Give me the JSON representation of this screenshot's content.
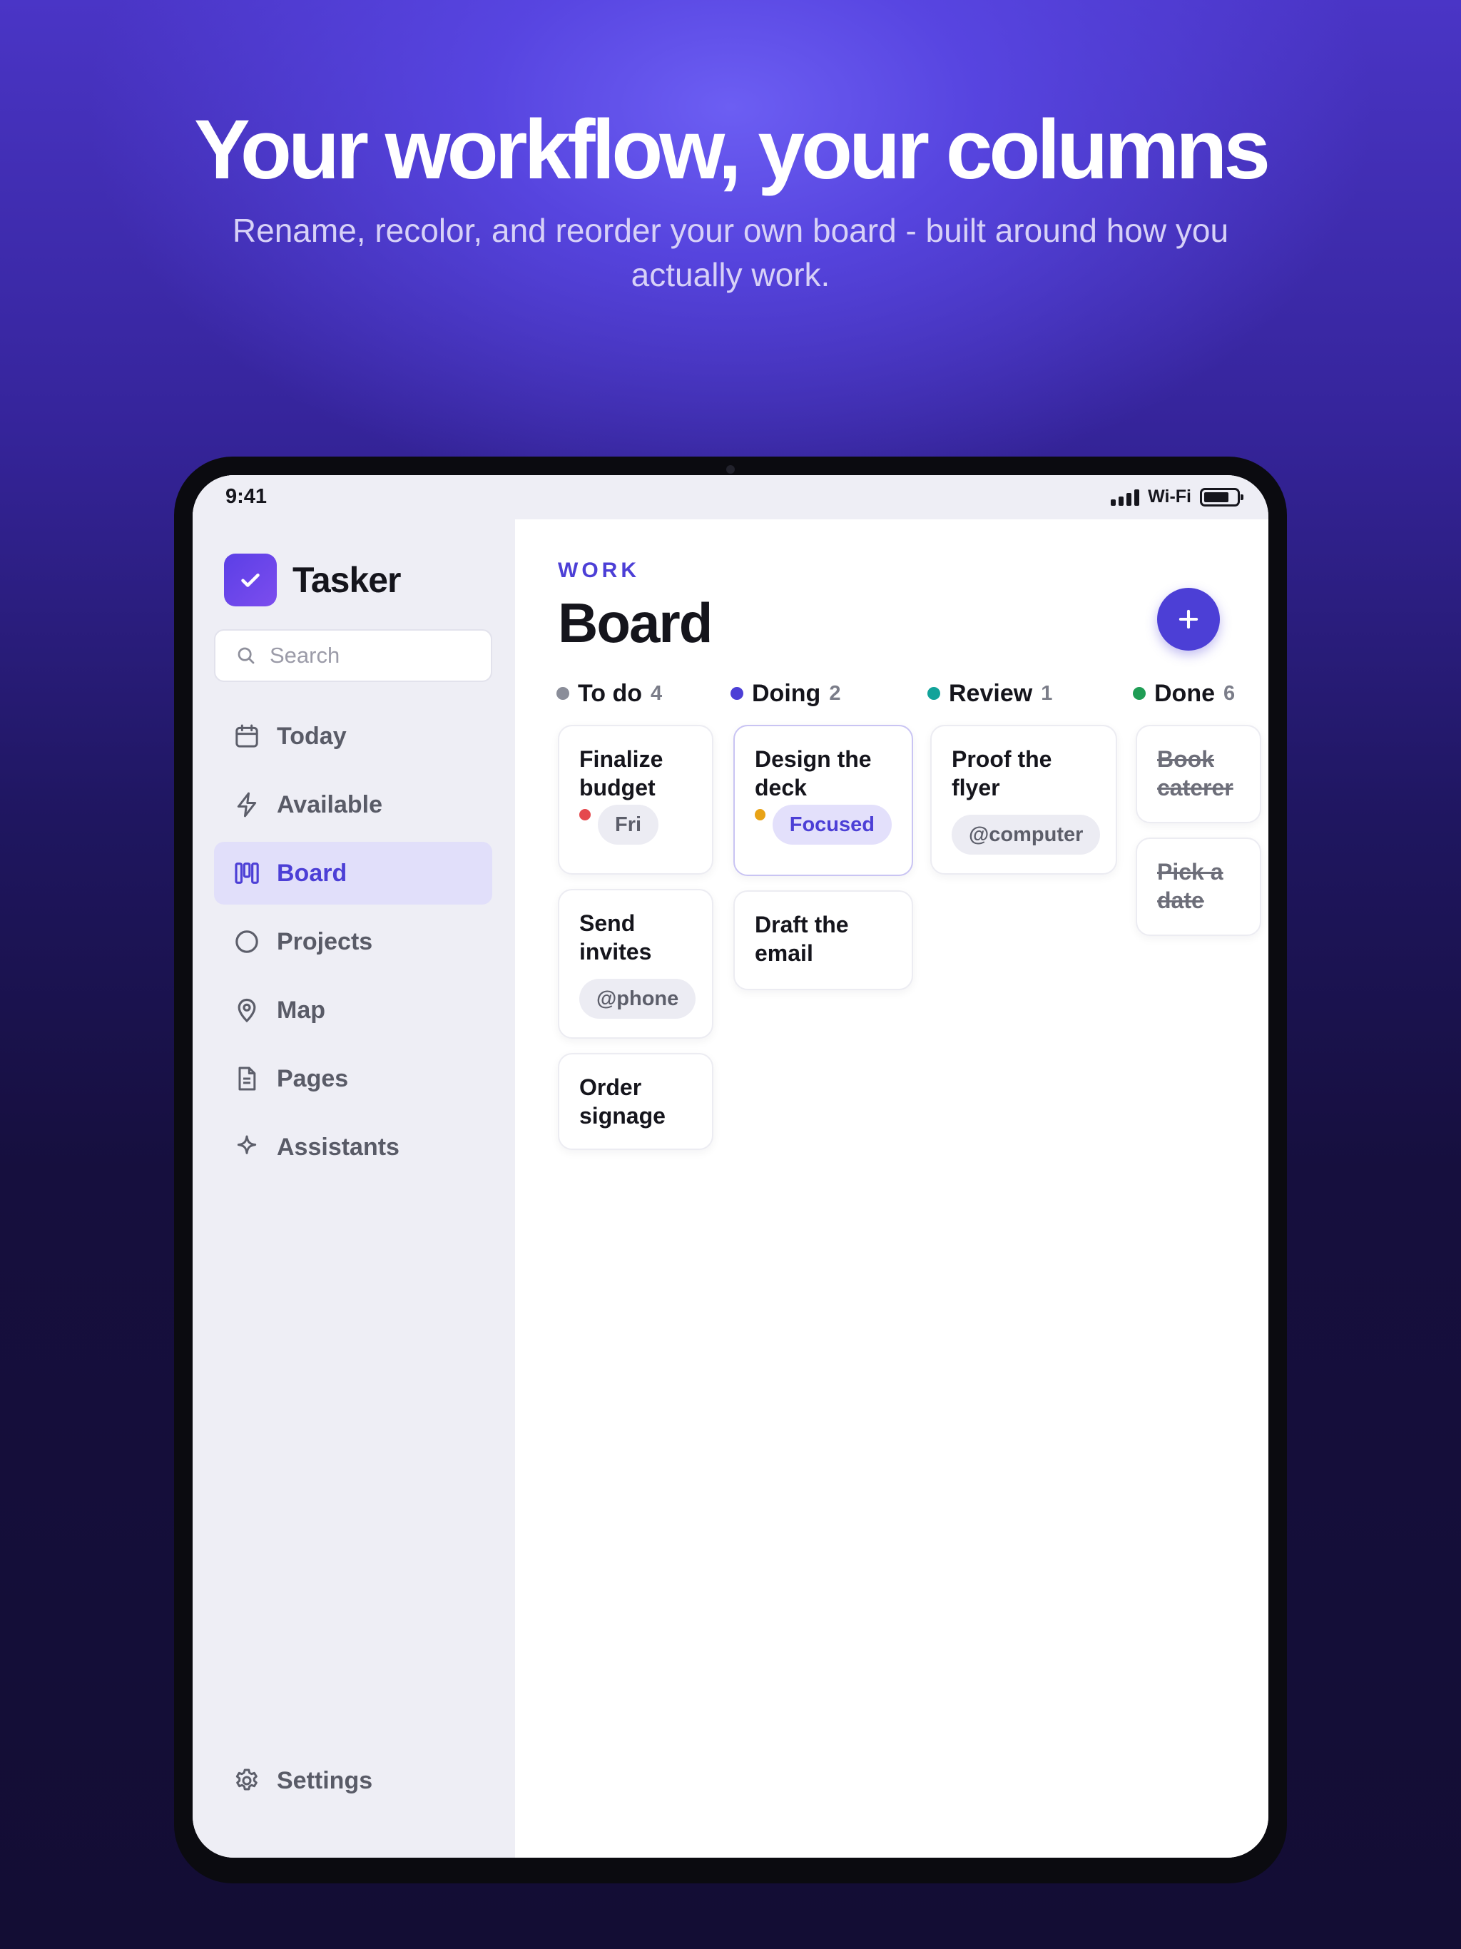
{
  "hero": {
    "title": "Your workflow, your columns",
    "subtitle": "Rename, recolor, and reorder your own board - built around how you actually work."
  },
  "status_bar": {
    "time": "9:41",
    "network": "Wi-Fi"
  },
  "sidebar": {
    "brand": "Tasker",
    "search_placeholder": "Search",
    "items": [
      {
        "label": "Today",
        "icon": "calendar-icon",
        "active": false
      },
      {
        "label": "Available",
        "icon": "bolt-icon",
        "active": false
      },
      {
        "label": "Board",
        "icon": "board-icon",
        "active": true
      },
      {
        "label": "Projects",
        "icon": "circle-icon",
        "active": false
      },
      {
        "label": "Map",
        "icon": "map-pin-icon",
        "active": false
      },
      {
        "label": "Pages",
        "icon": "document-icon",
        "active": false
      },
      {
        "label": "Assistants",
        "icon": "sparkle-icon",
        "active": false
      }
    ],
    "settings_label": "Settings"
  },
  "main": {
    "eyebrow": "WORK",
    "title": "Board",
    "add_button_icon": "plus-icon",
    "columns": [
      {
        "name": "To do",
        "count": "4",
        "color": "#8a8d99",
        "cards": [
          {
            "title": "Finalize budget",
            "priority_color": "#e5484d",
            "chip": "Fri"
          },
          {
            "title": "Send invites",
            "chip": "@phone"
          },
          {
            "title": "Order signage"
          }
        ]
      },
      {
        "name": "Doing",
        "count": "2",
        "color": "#4c3fd6",
        "cards": [
          {
            "title": "Design the deck",
            "priority_color": "#e8a317",
            "chip": "Focused"
          },
          {
            "title": "Draft the email"
          }
        ]
      },
      {
        "name": "Review",
        "count": "1",
        "color": "#12a39a",
        "cards": [
          {
            "title": "Proof the flyer",
            "chip": "@computer"
          }
        ]
      },
      {
        "name": "Done",
        "count": "6",
        "color": "#1f9d55",
        "cards": [
          {
            "title": "Book caterer"
          },
          {
            "title": "Pick a date"
          }
        ]
      }
    ]
  }
}
